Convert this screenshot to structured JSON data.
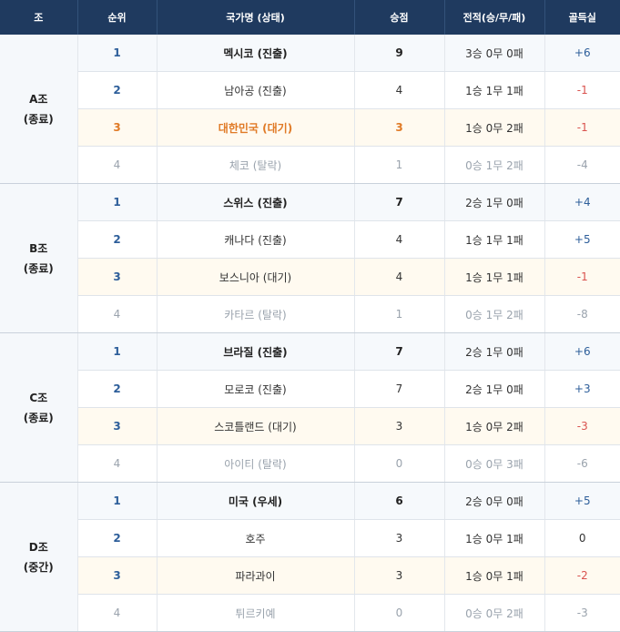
{
  "headers": {
    "group": "조",
    "rank": "순위",
    "team": "국가명 (상태)",
    "points": "승점",
    "record": "전적(승/무/패)",
    "goal_diff": "골득실"
  },
  "groups": [
    {
      "name": "A조",
      "status": "(종료)",
      "rows": [
        {
          "rank": "1",
          "team": "멕시코 (진출)",
          "points": "9",
          "record": "3승 0무 0패",
          "goal_diff": "+6",
          "state": "advance",
          "gd_sign": "pos"
        },
        {
          "rank": "2",
          "team": "남아공 (진출)",
          "points": "4",
          "record": "1승 1무 1패",
          "goal_diff": "-1",
          "state": "normal",
          "gd_sign": "neg"
        },
        {
          "rank": "3",
          "team": "대한민국 (대기)",
          "points": "3",
          "record": "1승 0무 2패",
          "goal_diff": "-1",
          "state": "korea",
          "gd_sign": "neg"
        },
        {
          "rank": "4",
          "team": "체코 (탈락)",
          "points": "1",
          "record": "0승 1무 2패",
          "goal_diff": "-4",
          "state": "out",
          "gd_sign": "neg"
        }
      ]
    },
    {
      "name": "B조",
      "status": "(종료)",
      "rows": [
        {
          "rank": "1",
          "team": "스위스 (진출)",
          "points": "7",
          "record": "2승 1무 0패",
          "goal_diff": "+4",
          "state": "advance",
          "gd_sign": "pos"
        },
        {
          "rank": "2",
          "team": "캐나다 (진출)",
          "points": "4",
          "record": "1승 1무 1패",
          "goal_diff": "+5",
          "state": "normal",
          "gd_sign": "pos"
        },
        {
          "rank": "3",
          "team": "보스니아 (대기)",
          "points": "4",
          "record": "1승 1무 1패",
          "goal_diff": "-1",
          "state": "wait",
          "gd_sign": "neg"
        },
        {
          "rank": "4",
          "team": "카타르 (탈락)",
          "points": "1",
          "record": "0승 1무 2패",
          "goal_diff": "-8",
          "state": "out",
          "gd_sign": "neg"
        }
      ]
    },
    {
      "name": "C조",
      "status": "(종료)",
      "rows": [
        {
          "rank": "1",
          "team": "브라질 (진출)",
          "points": "7",
          "record": "2승 1무 0패",
          "goal_diff": "+6",
          "state": "advance",
          "gd_sign": "pos"
        },
        {
          "rank": "2",
          "team": "모로코 (진출)",
          "points": "7",
          "record": "2승 1무 0패",
          "goal_diff": "+3",
          "state": "normal",
          "gd_sign": "pos"
        },
        {
          "rank": "3",
          "team": "스코틀랜드 (대기)",
          "points": "3",
          "record": "1승 0무 2패",
          "goal_diff": "-3",
          "state": "wait",
          "gd_sign": "neg"
        },
        {
          "rank": "4",
          "team": "아이티 (탈락)",
          "points": "0",
          "record": "0승 0무 3패",
          "goal_diff": "-6",
          "state": "out",
          "gd_sign": "neg"
        }
      ]
    },
    {
      "name": "D조",
      "status": "(중간)",
      "rows": [
        {
          "rank": "1",
          "team": "미국 (우세)",
          "points": "6",
          "record": "2승 0무 0패",
          "goal_diff": "+5",
          "state": "advance",
          "gd_sign": "pos"
        },
        {
          "rank": "2",
          "team": "호주",
          "points": "3",
          "record": "1승 0무 1패",
          "goal_diff": "0",
          "state": "normal",
          "gd_sign": "zero"
        },
        {
          "rank": "3",
          "team": "파라과이",
          "points": "3",
          "record": "1승 0무 1패",
          "goal_diff": "-2",
          "state": "wait",
          "gd_sign": "neg"
        },
        {
          "rank": "4",
          "team": "튀르키예",
          "points": "0",
          "record": "0승 0무 2패",
          "goal_diff": "-3",
          "state": "out",
          "gd_sign": "neg"
        }
      ]
    }
  ],
  "colors": {
    "header_bg": "#1f3a5f",
    "korea_highlight": "#e07a26",
    "positive_gd": "#2d5e9a",
    "negative_gd": "#d9534f"
  }
}
